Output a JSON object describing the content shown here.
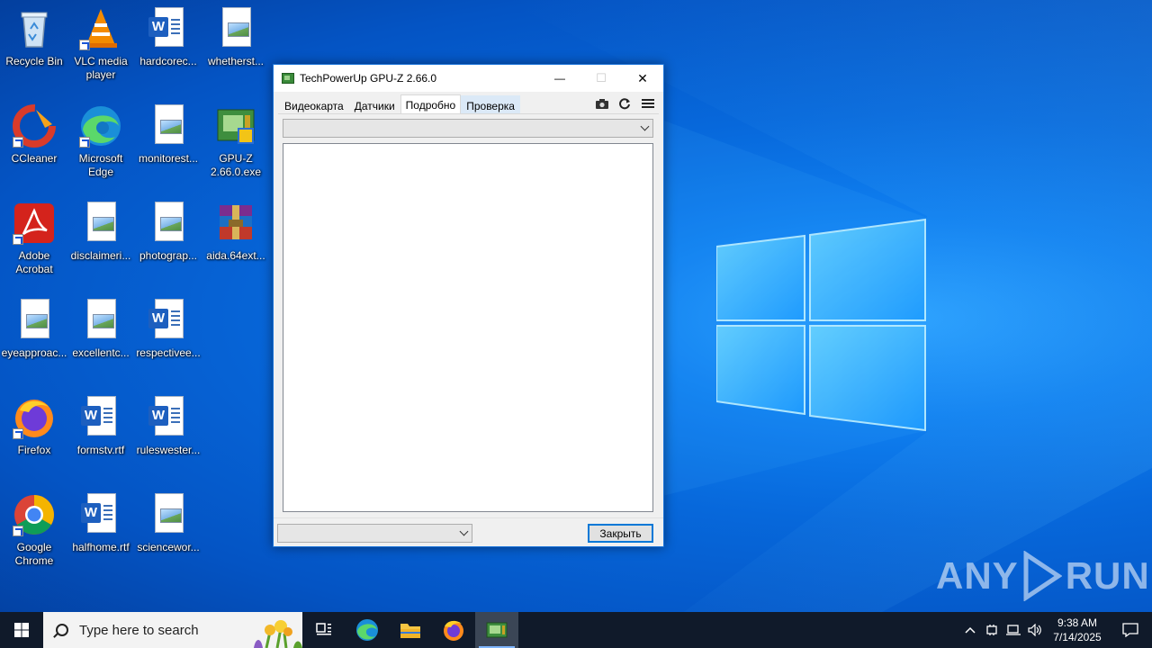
{
  "desktop": {
    "icons": [
      {
        "id": "recycle-bin",
        "label": "Recycle Bin"
      },
      {
        "id": "vlc",
        "label": "VLC media player"
      },
      {
        "id": "hardcorec",
        "label": "hardcorec..."
      },
      {
        "id": "whetherst",
        "label": "whetherst..."
      },
      {
        "id": "ccleaner",
        "label": "CCleaner"
      },
      {
        "id": "edge",
        "label": "Microsoft Edge"
      },
      {
        "id": "monitorest",
        "label": "monitorest..."
      },
      {
        "id": "gpuz-exe",
        "label": "GPU-Z 2.66.0.exe"
      },
      {
        "id": "acrobat",
        "label": "Adobe Acrobat"
      },
      {
        "id": "disclaimeri",
        "label": "disclaimeri..."
      },
      {
        "id": "photograp",
        "label": "photograp..."
      },
      {
        "id": "aida",
        "label": "aida.64ext..."
      },
      {
        "id": "eyeapproac",
        "label": "eyeapproac..."
      },
      {
        "id": "excellentc",
        "label": "excellentc..."
      },
      {
        "id": "respectivee",
        "label": "respectivee..."
      },
      {
        "id": "firefox",
        "label": "Firefox"
      },
      {
        "id": "formstv",
        "label": "formstv.rtf"
      },
      {
        "id": "ruleswester",
        "label": "ruleswester..."
      },
      {
        "id": "chrome",
        "label": "Google Chrome"
      },
      {
        "id": "halfhome",
        "label": "halfhome.rtf"
      },
      {
        "id": "sciencewor",
        "label": "sciencewor..."
      }
    ]
  },
  "window": {
    "title": "TechPowerUp GPU-Z 2.66.0",
    "minimize": "—",
    "maximize": "☐",
    "close": "✕",
    "tabs": [
      {
        "label": "Видеокарта"
      },
      {
        "label": "Датчики"
      },
      {
        "label": "Подробно"
      },
      {
        "label": "Проверка"
      }
    ],
    "active_tab": "Подробно",
    "device_select_value": "",
    "gpu_select_value": "",
    "close_button": "Закрыть"
  },
  "watermark": {
    "left": "ANY",
    "right": "RUN"
  },
  "taskbar": {
    "search_placeholder": "Type here to search",
    "time": "9:38 AM",
    "date": "7/14/2025"
  }
}
